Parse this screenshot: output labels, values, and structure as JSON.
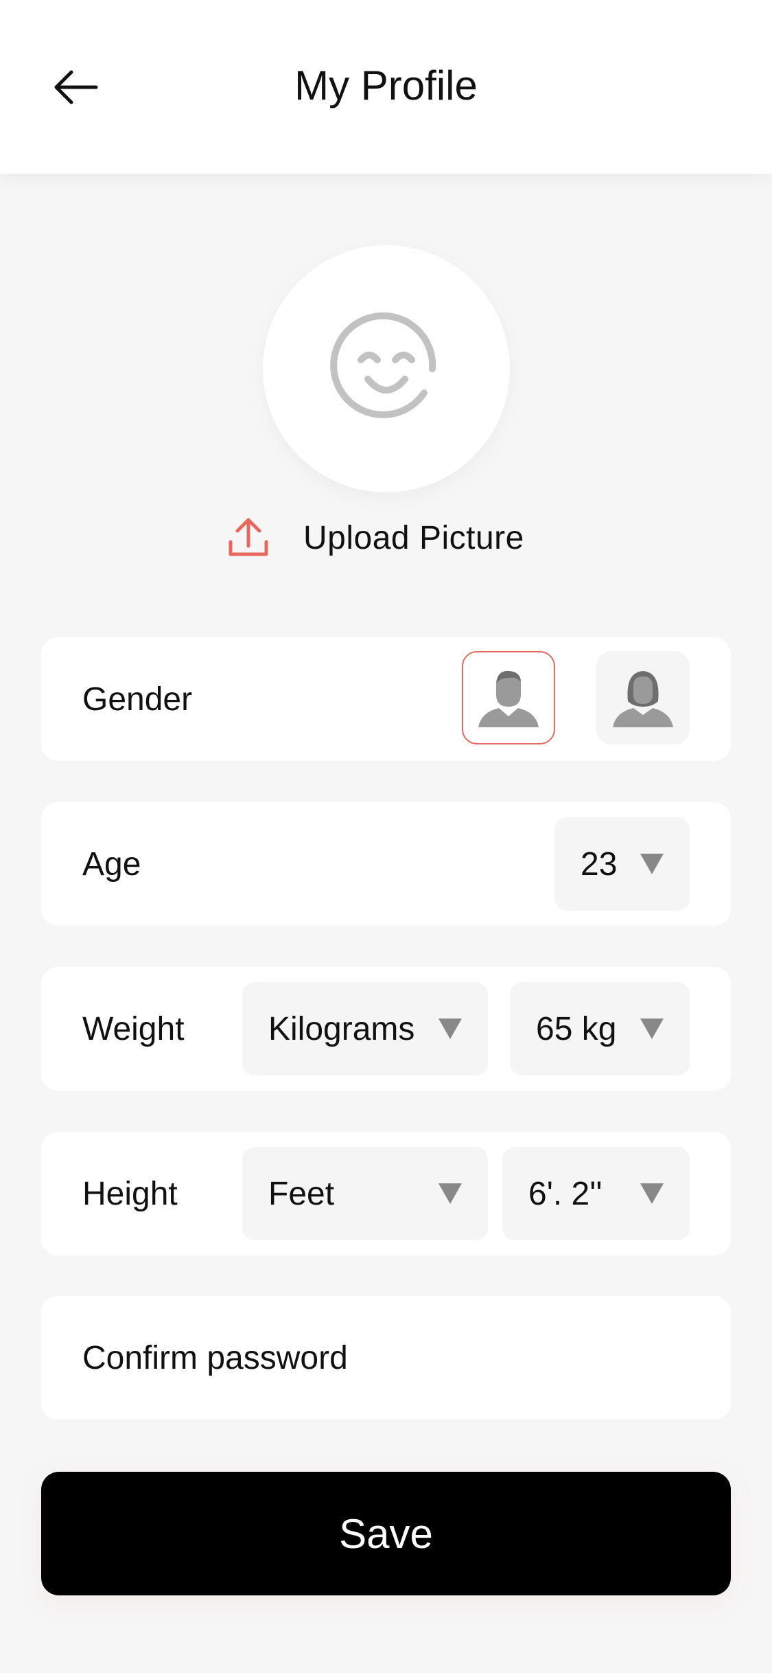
{
  "header": {
    "title": "My Profile",
    "back_icon": "arrow-left-icon"
  },
  "avatar": {
    "icon": "smiley-face-icon",
    "icon_color": "#c2c2c2"
  },
  "upload": {
    "label": "Upload Picture",
    "icon": "upload-icon",
    "icon_color": "#e8685d"
  },
  "gender": {
    "label": "Gender",
    "options": [
      "male-avatar-icon",
      "female-avatar-icon"
    ],
    "selected": "male",
    "accent": "#e8685d"
  },
  "age": {
    "label": "Age",
    "value": "23"
  },
  "weight": {
    "label": "Weight",
    "unit": "Kilograms",
    "value": "65 kg"
  },
  "height": {
    "label": "Height",
    "unit": "Feet",
    "value": "6'. 2''"
  },
  "password": {
    "placeholder": "Confirm password"
  },
  "save": {
    "label": "Save"
  },
  "colors": {
    "background": "#f6f6f6",
    "card": "#ffffff",
    "select_bg": "#f5f5f5",
    "caret": "#888888",
    "button": "#000000"
  }
}
